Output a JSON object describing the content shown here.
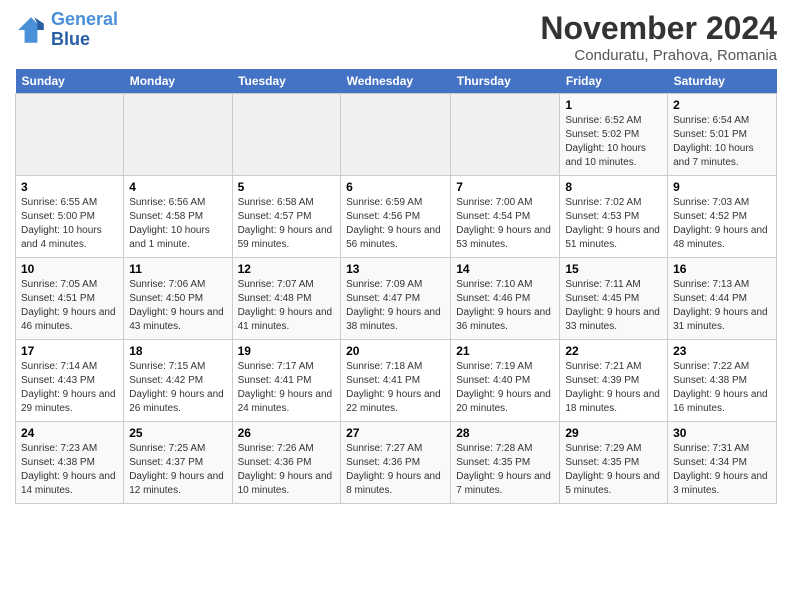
{
  "logo": {
    "line1": "General",
    "line2": "Blue"
  },
  "title": "November 2024",
  "subtitle": "Conduratu, Prahova, Romania",
  "weekdays": [
    "Sunday",
    "Monday",
    "Tuesday",
    "Wednesday",
    "Thursday",
    "Friday",
    "Saturday"
  ],
  "weeks": [
    [
      {
        "day": "",
        "info": ""
      },
      {
        "day": "",
        "info": ""
      },
      {
        "day": "",
        "info": ""
      },
      {
        "day": "",
        "info": ""
      },
      {
        "day": "",
        "info": ""
      },
      {
        "day": "1",
        "info": "Sunrise: 6:52 AM\nSunset: 5:02 PM\nDaylight: 10 hours and 10 minutes."
      },
      {
        "day": "2",
        "info": "Sunrise: 6:54 AM\nSunset: 5:01 PM\nDaylight: 10 hours and 7 minutes."
      }
    ],
    [
      {
        "day": "3",
        "info": "Sunrise: 6:55 AM\nSunset: 5:00 PM\nDaylight: 10 hours and 4 minutes."
      },
      {
        "day": "4",
        "info": "Sunrise: 6:56 AM\nSunset: 4:58 PM\nDaylight: 10 hours and 1 minute."
      },
      {
        "day": "5",
        "info": "Sunrise: 6:58 AM\nSunset: 4:57 PM\nDaylight: 9 hours and 59 minutes."
      },
      {
        "day": "6",
        "info": "Sunrise: 6:59 AM\nSunset: 4:56 PM\nDaylight: 9 hours and 56 minutes."
      },
      {
        "day": "7",
        "info": "Sunrise: 7:00 AM\nSunset: 4:54 PM\nDaylight: 9 hours and 53 minutes."
      },
      {
        "day": "8",
        "info": "Sunrise: 7:02 AM\nSunset: 4:53 PM\nDaylight: 9 hours and 51 minutes."
      },
      {
        "day": "9",
        "info": "Sunrise: 7:03 AM\nSunset: 4:52 PM\nDaylight: 9 hours and 48 minutes."
      }
    ],
    [
      {
        "day": "10",
        "info": "Sunrise: 7:05 AM\nSunset: 4:51 PM\nDaylight: 9 hours and 46 minutes."
      },
      {
        "day": "11",
        "info": "Sunrise: 7:06 AM\nSunset: 4:50 PM\nDaylight: 9 hours and 43 minutes."
      },
      {
        "day": "12",
        "info": "Sunrise: 7:07 AM\nSunset: 4:48 PM\nDaylight: 9 hours and 41 minutes."
      },
      {
        "day": "13",
        "info": "Sunrise: 7:09 AM\nSunset: 4:47 PM\nDaylight: 9 hours and 38 minutes."
      },
      {
        "day": "14",
        "info": "Sunrise: 7:10 AM\nSunset: 4:46 PM\nDaylight: 9 hours and 36 minutes."
      },
      {
        "day": "15",
        "info": "Sunrise: 7:11 AM\nSunset: 4:45 PM\nDaylight: 9 hours and 33 minutes."
      },
      {
        "day": "16",
        "info": "Sunrise: 7:13 AM\nSunset: 4:44 PM\nDaylight: 9 hours and 31 minutes."
      }
    ],
    [
      {
        "day": "17",
        "info": "Sunrise: 7:14 AM\nSunset: 4:43 PM\nDaylight: 9 hours and 29 minutes."
      },
      {
        "day": "18",
        "info": "Sunrise: 7:15 AM\nSunset: 4:42 PM\nDaylight: 9 hours and 26 minutes."
      },
      {
        "day": "19",
        "info": "Sunrise: 7:17 AM\nSunset: 4:41 PM\nDaylight: 9 hours and 24 minutes."
      },
      {
        "day": "20",
        "info": "Sunrise: 7:18 AM\nSunset: 4:41 PM\nDaylight: 9 hours and 22 minutes."
      },
      {
        "day": "21",
        "info": "Sunrise: 7:19 AM\nSunset: 4:40 PM\nDaylight: 9 hours and 20 minutes."
      },
      {
        "day": "22",
        "info": "Sunrise: 7:21 AM\nSunset: 4:39 PM\nDaylight: 9 hours and 18 minutes."
      },
      {
        "day": "23",
        "info": "Sunrise: 7:22 AM\nSunset: 4:38 PM\nDaylight: 9 hours and 16 minutes."
      }
    ],
    [
      {
        "day": "24",
        "info": "Sunrise: 7:23 AM\nSunset: 4:38 PM\nDaylight: 9 hours and 14 minutes."
      },
      {
        "day": "25",
        "info": "Sunrise: 7:25 AM\nSunset: 4:37 PM\nDaylight: 9 hours and 12 minutes."
      },
      {
        "day": "26",
        "info": "Sunrise: 7:26 AM\nSunset: 4:36 PM\nDaylight: 9 hours and 10 minutes."
      },
      {
        "day": "27",
        "info": "Sunrise: 7:27 AM\nSunset: 4:36 PM\nDaylight: 9 hours and 8 minutes."
      },
      {
        "day": "28",
        "info": "Sunrise: 7:28 AM\nSunset: 4:35 PM\nDaylight: 9 hours and 7 minutes."
      },
      {
        "day": "29",
        "info": "Sunrise: 7:29 AM\nSunset: 4:35 PM\nDaylight: 9 hours and 5 minutes."
      },
      {
        "day": "30",
        "info": "Sunrise: 7:31 AM\nSunset: 4:34 PM\nDaylight: 9 hours and 3 minutes."
      }
    ]
  ]
}
